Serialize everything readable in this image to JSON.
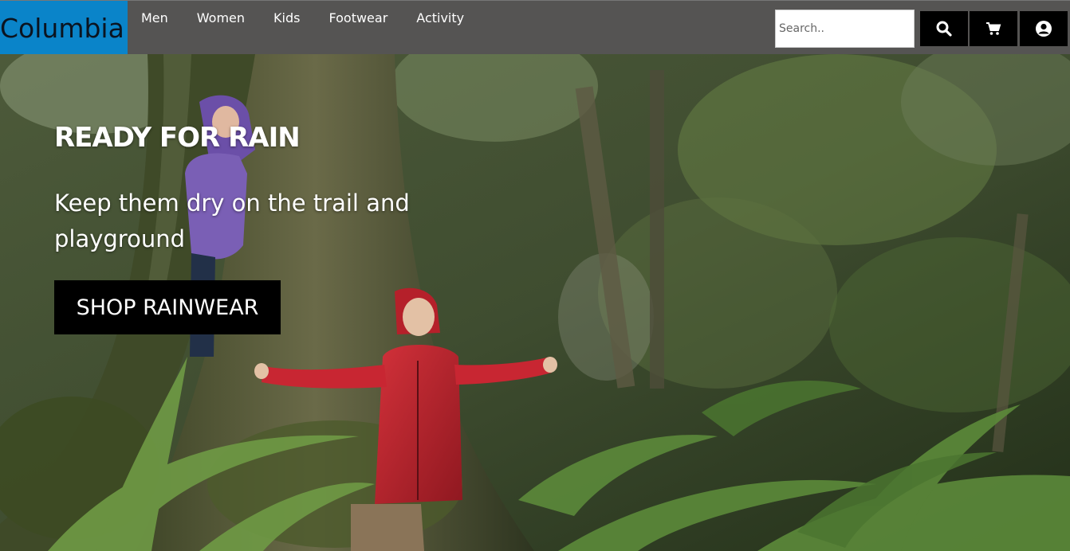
{
  "brand": {
    "logo_text": "Columbia"
  },
  "nav": {
    "items": [
      {
        "label": "Men"
      },
      {
        "label": "Women"
      },
      {
        "label": "Kids"
      },
      {
        "label": "Footwear"
      },
      {
        "label": "Activity"
      }
    ]
  },
  "search": {
    "placeholder": "Search.."
  },
  "icons": {
    "search": "search-icon",
    "cart": "cart-icon",
    "account": "account-icon"
  },
  "hero": {
    "title": "READY FOR RAIN",
    "subtitle": "Keep them dry on the trail and playground",
    "cta_label": "SHOP RAINWEAR"
  },
  "colors": {
    "header_bg": "#555453",
    "logo_bg": "#0a84c9",
    "button_bg": "#000000",
    "jacket_red": "#b5202a",
    "jacket_purple": "#7a5fb5"
  }
}
